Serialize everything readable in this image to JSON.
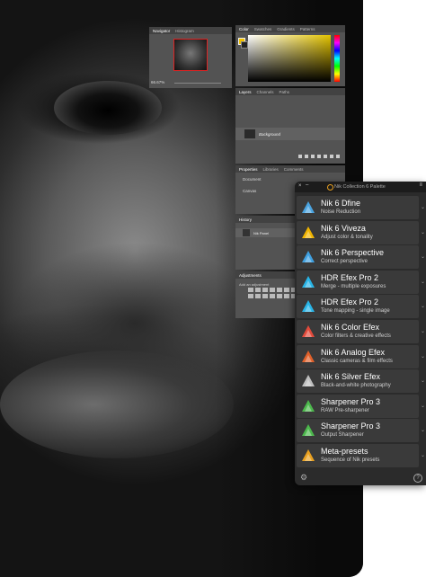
{
  "photoshop": {
    "navigator": {
      "tabs": [
        "Navigator",
        "Histogram"
      ],
      "zoom": "66.67%"
    },
    "color": {
      "tabs": [
        "Color",
        "Swatches",
        "Gradients",
        "Patterns"
      ],
      "foreground": "#f0c000"
    },
    "layers": {
      "tabs": [
        "Layers",
        "Channels",
        "Paths"
      ],
      "layer_name": "Background"
    },
    "properties": {
      "tabs": [
        "Properties",
        "Libraries",
        "Comments"
      ],
      "doc_label": "Document",
      "canvas_label": "Canvas"
    },
    "history": {
      "tab": "History",
      "item": "Nik Panel"
    },
    "adjustments": {
      "tab": "Adjustments",
      "hint": "Add an adjustment"
    }
  },
  "nik": {
    "title": "Nik Collection 6 Palette",
    "accent": "#e8a020",
    "items": [
      {
        "name": "Nik 6 Dfine",
        "sub": "Noise Reduction",
        "icon": "dfine-icon",
        "color": "#4aa3df"
      },
      {
        "name": "Nik 6 Viveza",
        "sub": "Adjust color & tonality",
        "icon": "viveza-icon",
        "color": "#f0b400"
      },
      {
        "name": "Nik 6 Perspective",
        "sub": "Correct perspective",
        "icon": "perspective-icon",
        "color": "#3fa0e0"
      },
      {
        "name": "HDR Efex Pro 2",
        "sub": "Merge - multiple exposures",
        "icon": "hdr-icon",
        "color": "#28b4e6"
      },
      {
        "name": "HDR Efex Pro 2",
        "sub": "Tone mapping - single image",
        "icon": "hdr-icon",
        "color": "#28b4e6"
      },
      {
        "name": "Nik 6 Color Efex",
        "sub": "Color filters & creative effects",
        "icon": "color-efex-icon",
        "color": "#e24a3b"
      },
      {
        "name": "Nik 6 Analog Efex",
        "sub": "Classic cameras & film effects",
        "icon": "analog-efex-icon",
        "color": "#e0602a"
      },
      {
        "name": "Nik 6 Silver Efex",
        "sub": "Black-and-white photography",
        "icon": "silver-efex-icon",
        "color": "#bfbfbf"
      },
      {
        "name": "Sharpener Pro 3",
        "sub": "RAW Pre-sharpener",
        "icon": "sharpener-icon",
        "color": "#4cb84c"
      },
      {
        "name": "Sharpener Pro 3",
        "sub": "Output Sharpener",
        "icon": "sharpener-icon",
        "color": "#4cb84c"
      },
      {
        "name": "Meta-presets",
        "sub": "Sequence of Nik presets",
        "icon": "meta-presets-icon",
        "color": "#e8a020"
      }
    ]
  }
}
